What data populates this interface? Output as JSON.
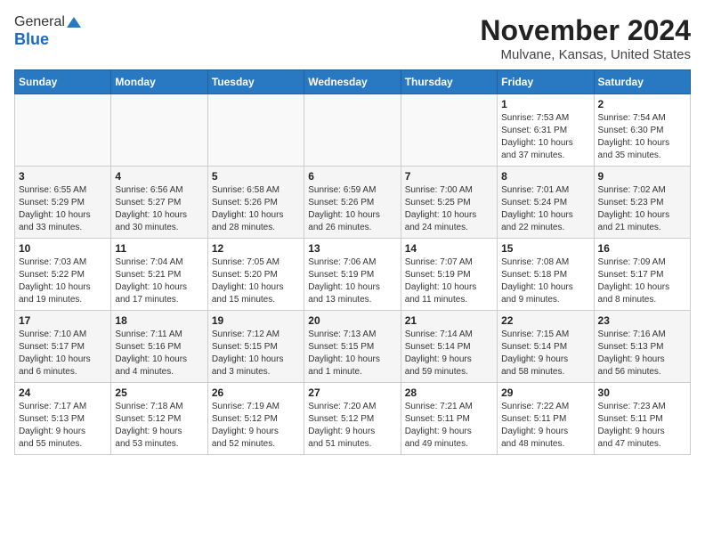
{
  "logo": {
    "general": "General",
    "blue": "Blue"
  },
  "title": "November 2024",
  "location": "Mulvane, Kansas, United States",
  "days_of_week": [
    "Sunday",
    "Monday",
    "Tuesday",
    "Wednesday",
    "Thursday",
    "Friday",
    "Saturday"
  ],
  "weeks": [
    [
      {
        "day": "",
        "detail": ""
      },
      {
        "day": "",
        "detail": ""
      },
      {
        "day": "",
        "detail": ""
      },
      {
        "day": "",
        "detail": ""
      },
      {
        "day": "",
        "detail": ""
      },
      {
        "day": "1",
        "detail": "Sunrise: 7:53 AM\nSunset: 6:31 PM\nDaylight: 10 hours\nand 37 minutes."
      },
      {
        "day": "2",
        "detail": "Sunrise: 7:54 AM\nSunset: 6:30 PM\nDaylight: 10 hours\nand 35 minutes."
      }
    ],
    [
      {
        "day": "3",
        "detail": "Sunrise: 6:55 AM\nSunset: 5:29 PM\nDaylight: 10 hours\nand 33 minutes."
      },
      {
        "day": "4",
        "detail": "Sunrise: 6:56 AM\nSunset: 5:27 PM\nDaylight: 10 hours\nand 30 minutes."
      },
      {
        "day": "5",
        "detail": "Sunrise: 6:58 AM\nSunset: 5:26 PM\nDaylight: 10 hours\nand 28 minutes."
      },
      {
        "day": "6",
        "detail": "Sunrise: 6:59 AM\nSunset: 5:26 PM\nDaylight: 10 hours\nand 26 minutes."
      },
      {
        "day": "7",
        "detail": "Sunrise: 7:00 AM\nSunset: 5:25 PM\nDaylight: 10 hours\nand 24 minutes."
      },
      {
        "day": "8",
        "detail": "Sunrise: 7:01 AM\nSunset: 5:24 PM\nDaylight: 10 hours\nand 22 minutes."
      },
      {
        "day": "9",
        "detail": "Sunrise: 7:02 AM\nSunset: 5:23 PM\nDaylight: 10 hours\nand 21 minutes."
      }
    ],
    [
      {
        "day": "10",
        "detail": "Sunrise: 7:03 AM\nSunset: 5:22 PM\nDaylight: 10 hours\nand 19 minutes."
      },
      {
        "day": "11",
        "detail": "Sunrise: 7:04 AM\nSunset: 5:21 PM\nDaylight: 10 hours\nand 17 minutes."
      },
      {
        "day": "12",
        "detail": "Sunrise: 7:05 AM\nSunset: 5:20 PM\nDaylight: 10 hours\nand 15 minutes."
      },
      {
        "day": "13",
        "detail": "Sunrise: 7:06 AM\nSunset: 5:19 PM\nDaylight: 10 hours\nand 13 minutes."
      },
      {
        "day": "14",
        "detail": "Sunrise: 7:07 AM\nSunset: 5:19 PM\nDaylight: 10 hours\nand 11 minutes."
      },
      {
        "day": "15",
        "detail": "Sunrise: 7:08 AM\nSunset: 5:18 PM\nDaylight: 10 hours\nand 9 minutes."
      },
      {
        "day": "16",
        "detail": "Sunrise: 7:09 AM\nSunset: 5:17 PM\nDaylight: 10 hours\nand 8 minutes."
      }
    ],
    [
      {
        "day": "17",
        "detail": "Sunrise: 7:10 AM\nSunset: 5:17 PM\nDaylight: 10 hours\nand 6 minutes."
      },
      {
        "day": "18",
        "detail": "Sunrise: 7:11 AM\nSunset: 5:16 PM\nDaylight: 10 hours\nand 4 minutes."
      },
      {
        "day": "19",
        "detail": "Sunrise: 7:12 AM\nSunset: 5:15 PM\nDaylight: 10 hours\nand 3 minutes."
      },
      {
        "day": "20",
        "detail": "Sunrise: 7:13 AM\nSunset: 5:15 PM\nDaylight: 10 hours\nand 1 minute."
      },
      {
        "day": "21",
        "detail": "Sunrise: 7:14 AM\nSunset: 5:14 PM\nDaylight: 9 hours\nand 59 minutes."
      },
      {
        "day": "22",
        "detail": "Sunrise: 7:15 AM\nSunset: 5:14 PM\nDaylight: 9 hours\nand 58 minutes."
      },
      {
        "day": "23",
        "detail": "Sunrise: 7:16 AM\nSunset: 5:13 PM\nDaylight: 9 hours\nand 56 minutes."
      }
    ],
    [
      {
        "day": "24",
        "detail": "Sunrise: 7:17 AM\nSunset: 5:13 PM\nDaylight: 9 hours\nand 55 minutes."
      },
      {
        "day": "25",
        "detail": "Sunrise: 7:18 AM\nSunset: 5:12 PM\nDaylight: 9 hours\nand 53 minutes."
      },
      {
        "day": "26",
        "detail": "Sunrise: 7:19 AM\nSunset: 5:12 PM\nDaylight: 9 hours\nand 52 minutes."
      },
      {
        "day": "27",
        "detail": "Sunrise: 7:20 AM\nSunset: 5:12 PM\nDaylight: 9 hours\nand 51 minutes."
      },
      {
        "day": "28",
        "detail": "Sunrise: 7:21 AM\nSunset: 5:11 PM\nDaylight: 9 hours\nand 49 minutes."
      },
      {
        "day": "29",
        "detail": "Sunrise: 7:22 AM\nSunset: 5:11 PM\nDaylight: 9 hours\nand 48 minutes."
      },
      {
        "day": "30",
        "detail": "Sunrise: 7:23 AM\nSunset: 5:11 PM\nDaylight: 9 hours\nand 47 minutes."
      }
    ]
  ]
}
